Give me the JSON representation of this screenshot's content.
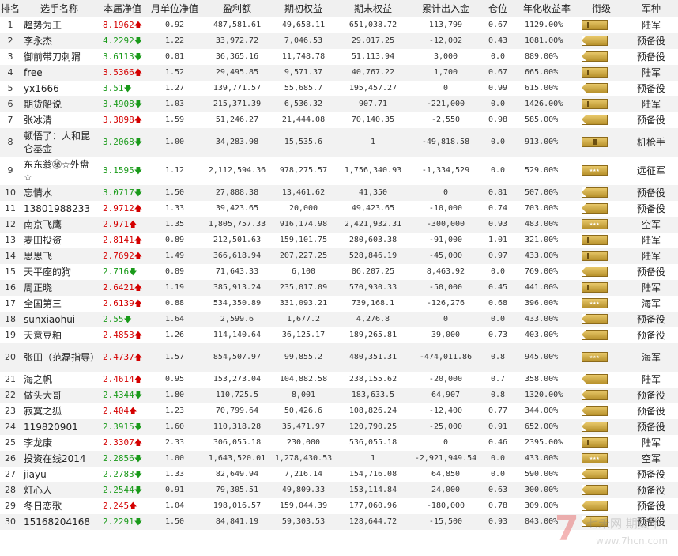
{
  "headers": [
    "排名",
    "选手名称",
    "本届净值",
    "月单位净值",
    "盈利额",
    "期初权益",
    "期末权益",
    "累计出入金",
    "仓位",
    "年化收益率",
    "衔级",
    "军种"
  ],
  "rows": [
    {
      "rank": "1",
      "name": "趋势为王",
      "nav": "8.1962",
      "dir": "up",
      "monthly": "0.92",
      "profit": "487,581.61",
      "initial": "49,658.11",
      "final": "651,038.72",
      "flow": "113,799",
      "position": "0.67",
      "annual": "1129.00%",
      "badge": "bar",
      "army": "陆军"
    },
    {
      "rank": "2",
      "name": "李永杰",
      "nav": "4.2292",
      "dir": "down",
      "monthly": "1.22",
      "profit": "33,972.72",
      "initial": "7,046.53",
      "final": "29,017.25",
      "flow": "-12,002",
      "position": "0.43",
      "annual": "1081.00%",
      "badge": "chev",
      "army": "预备役"
    },
    {
      "rank": "3",
      "name": "御前带刀刺猬",
      "nav": "3.6113",
      "dir": "down",
      "monthly": "0.81",
      "profit": "36,365.16",
      "initial": "11,748.78",
      "final": "51,113.94",
      "flow": "3,000",
      "position": "0.0",
      "annual": "889.00%",
      "badge": "chev",
      "army": "预备役"
    },
    {
      "rank": "4",
      "name": "free",
      "nav": "3.5366",
      "dir": "up",
      "monthly": "1.52",
      "profit": "29,495.85",
      "initial": "9,571.37",
      "final": "40,767.22",
      "flow": "1,700",
      "position": "0.67",
      "annual": "665.00%",
      "badge": "bar",
      "army": "陆军"
    },
    {
      "rank": "5",
      "name": "yx1666",
      "nav": "3.51",
      "dir": "down",
      "monthly": "1.27",
      "profit": "139,771.57",
      "initial": "55,685.7",
      "final": "195,457.27",
      "flow": "0",
      "position": "0.99",
      "annual": "615.00%",
      "badge": "chev",
      "army": "预备役"
    },
    {
      "rank": "6",
      "name": "期货船说",
      "nav": "3.4908",
      "dir": "down",
      "monthly": "1.03",
      "profit": "215,371.39",
      "initial": "6,536.32",
      "final": "907.71",
      "flow": "-221,000",
      "position": "0.0",
      "annual": "1426.00%",
      "badge": "bar",
      "army": "陆军"
    },
    {
      "rank": "7",
      "name": "张冰清",
      "nav": "3.3898",
      "dir": "up",
      "monthly": "1.59",
      "profit": "51,246.27",
      "initial": "21,444.08",
      "final": "70,140.35",
      "flow": "-2,550",
      "position": "0.98",
      "annual": "585.00%",
      "badge": "chev",
      "army": "预备役"
    },
    {
      "rank": "8",
      "name": "顿悟了：人和昆仑基金",
      "nav": "3.2068",
      "dir": "down",
      "monthly": "1.00",
      "profit": "34,283.98",
      "initial": "15,535.6",
      "final": "1",
      "flow": "-49,818.58",
      "position": "0.0",
      "annual": "913.00%",
      "badge": "bar3",
      "army": "机枪手"
    },
    {
      "rank": "9",
      "name": "东东翁㊙☆外盘☆",
      "nav": "3.1595",
      "dir": "down",
      "monthly": "1.12",
      "profit": "2,112,594.36",
      "initial": "978,275.57",
      "final": "1,756,340.93",
      "flow": "-1,334,529",
      "position": "0.0",
      "annual": "529.00%",
      "badge": "stars",
      "army": "远征军"
    },
    {
      "rank": "10",
      "name": "忘情水",
      "nav": "3.0717",
      "dir": "down",
      "monthly": "1.50",
      "profit": "27,888.38",
      "initial": "13,461.62",
      "final": "41,350",
      "flow": "0",
      "position": "0.81",
      "annual": "507.00%",
      "badge": "chev",
      "army": "预备役"
    },
    {
      "rank": "11",
      "name": "13801988233",
      "nav": "2.9712",
      "dir": "up",
      "monthly": "1.33",
      "profit": "39,423.65",
      "initial": "20,000",
      "final": "49,423.65",
      "flow": "-10,000",
      "position": "0.74",
      "annual": "703.00%",
      "badge": "chev",
      "army": "预备役"
    },
    {
      "rank": "12",
      "name": "南京飞鹰",
      "nav": "2.971",
      "dir": "up",
      "monthly": "1.35",
      "profit": "1,805,757.33",
      "initial": "916,174.98",
      "final": "2,421,932.31",
      "flow": "-300,000",
      "position": "0.93",
      "annual": "483.00%",
      "badge": "stars",
      "army": "空军"
    },
    {
      "rank": "13",
      "name": "麦田投资",
      "nav": "2.8141",
      "dir": "up",
      "monthly": "0.89",
      "profit": "212,501.63",
      "initial": "159,101.75",
      "final": "280,603.38",
      "flow": "-91,000",
      "position": "1.01",
      "annual": "321.00%",
      "badge": "bar",
      "army": "陆军"
    },
    {
      "rank": "14",
      "name": "思思飞",
      "nav": "2.7692",
      "dir": "up",
      "monthly": "1.49",
      "profit": "366,618.94",
      "initial": "207,227.25",
      "final": "528,846.19",
      "flow": "-45,000",
      "position": "0.97",
      "annual": "433.00%",
      "badge": "bar",
      "army": "陆军"
    },
    {
      "rank": "15",
      "name": "天平座的狗",
      "nav": "2.716",
      "dir": "down",
      "monthly": "0.89",
      "profit": "71,643.33",
      "initial": "6,100",
      "final": "86,207.25",
      "flow": "8,463.92",
      "position": "0.0",
      "annual": "769.00%",
      "badge": "chev",
      "army": "预备役"
    },
    {
      "rank": "16",
      "name": "周正晓",
      "nav": "2.6421",
      "dir": "up",
      "monthly": "1.19",
      "profit": "385,913.24",
      "initial": "235,017.09",
      "final": "570,930.33",
      "flow": "-50,000",
      "position": "0.45",
      "annual": "441.00%",
      "badge": "bar",
      "army": "陆军"
    },
    {
      "rank": "17",
      "name": "全国第三",
      "nav": "2.6139",
      "dir": "up",
      "monthly": "0.88",
      "profit": "534,350.89",
      "initial": "331,093.21",
      "final": "739,168.1",
      "flow": "-126,276",
      "position": "0.68",
      "annual": "396.00%",
      "badge": "stars",
      "army": "海军"
    },
    {
      "rank": "18",
      "name": "sunxiaohui",
      "nav": "2.55",
      "dir": "down",
      "monthly": "1.64",
      "profit": "2,599.6",
      "initial": "1,677.2",
      "final": "4,276.8",
      "flow": "0",
      "position": "0.0",
      "annual": "433.00%",
      "badge": "chev",
      "army": "预备役"
    },
    {
      "rank": "19",
      "name": "天意豆粕",
      "nav": "2.4853",
      "dir": "up",
      "monthly": "1.26",
      "profit": "114,140.64",
      "initial": "36,125.17",
      "final": "189,265.81",
      "flow": "39,000",
      "position": "0.73",
      "annual": "403.00%",
      "badge": "chev",
      "army": "预备役"
    },
    {
      "rank": "20",
      "name": "张田（范磊指导）",
      "nav": "2.4737",
      "dir": "up",
      "monthly": "1.57",
      "profit": "854,507.97",
      "initial": "99,855.2",
      "final": "480,351.31",
      "flow": "-474,011.86",
      "position": "0.8",
      "annual": "945.00%",
      "badge": "stars",
      "army": "海军"
    },
    {
      "rank": "21",
      "name": "海之帆",
      "nav": "2.4614",
      "dir": "up",
      "monthly": "0.95",
      "profit": "153,273.04",
      "initial": "104,882.58",
      "final": "238,155.62",
      "flow": "-20,000",
      "position": "0.7",
      "annual": "358.00%",
      "badge": "chev",
      "army": "陆军"
    },
    {
      "rank": "22",
      "name": "做头大哥",
      "nav": "2.4344",
      "dir": "down",
      "monthly": "1.80",
      "profit": "110,725.5",
      "initial": "8,001",
      "final": "183,633.5",
      "flow": "64,907",
      "position": "0.8",
      "annual": "1320.00%",
      "badge": "chev",
      "army": "预备役"
    },
    {
      "rank": "23",
      "name": "寂寞之狐",
      "nav": "2.404",
      "dir": "up",
      "monthly": "1.23",
      "profit": "70,799.64",
      "initial": "50,426.6",
      "final": "108,826.24",
      "flow": "-12,400",
      "position": "0.77",
      "annual": "344.00%",
      "badge": "chev",
      "army": "预备役"
    },
    {
      "rank": "24",
      "name": "119820901",
      "nav": "2.3915",
      "dir": "down",
      "monthly": "1.60",
      "profit": "110,318.28",
      "initial": "35,471.97",
      "final": "120,790.25",
      "flow": "-25,000",
      "position": "0.91",
      "annual": "652.00%",
      "badge": "chev",
      "army": "预备役"
    },
    {
      "rank": "25",
      "name": "李龙康",
      "nav": "2.3307",
      "dir": "up",
      "monthly": "2.33",
      "profit": "306,055.18",
      "initial": "230,000",
      "final": "536,055.18",
      "flow": "0",
      "position": "0.46",
      "annual": "2395.00%",
      "badge": "bar",
      "army": "陆军"
    },
    {
      "rank": "26",
      "name": "投资在线2014",
      "nav": "2.2856",
      "dir": "down",
      "monthly": "1.00",
      "profit": "1,643,520.01",
      "initial": "1,278,430.53",
      "final": "1",
      "flow": "-2,921,949.54",
      "position": "0.0",
      "annual": "433.00%",
      "badge": "stars",
      "army": "空军"
    },
    {
      "rank": "27",
      "name": "jiayu",
      "nav": "2.2783",
      "dir": "down",
      "monthly": "1.33",
      "profit": "82,649.94",
      "initial": "7,216.14",
      "final": "154,716.08",
      "flow": "64,850",
      "position": "0.0",
      "annual": "590.00%",
      "badge": "chev",
      "army": "预备役"
    },
    {
      "rank": "28",
      "name": "灯心人",
      "nav": "2.2544",
      "dir": "down",
      "monthly": "0.91",
      "profit": "79,305.51",
      "initial": "49,809.33",
      "final": "153,114.84",
      "flow": "24,000",
      "position": "0.63",
      "annual": "300.00%",
      "badge": "chev",
      "army": "预备役"
    },
    {
      "rank": "29",
      "name": "冬日恋歌",
      "nav": "2.245",
      "dir": "up",
      "monthly": "1.04",
      "profit": "198,016.57",
      "initial": "159,044.39",
      "final": "177,060.96",
      "flow": "-180,000",
      "position": "0.78",
      "annual": "309.00%",
      "badge": "chev",
      "army": "预备役"
    },
    {
      "rank": "30",
      "name": "15168204168",
      "nav": "2.2291",
      "dir": "down",
      "monthly": "1.50",
      "profit": "84,841.19",
      "initial": "59,303.53",
      "final": "128,644.72",
      "flow": "-15,500",
      "position": "0.93",
      "annual": "843.00%",
      "badge": "chev",
      "army": "预备役"
    }
  ],
  "watermark": {
    "logo": "7",
    "brand": "七禾网 期货中",
    "url": "www.7hcn.com"
  },
  "colors": {
    "up": "#d40000",
    "down": "#1a9a1a",
    "badge": "#c9a441"
  },
  "icons": {
    "up": "arrow-up-icon",
    "down": "arrow-down-icon",
    "rank": "rank-badge-icon"
  }
}
